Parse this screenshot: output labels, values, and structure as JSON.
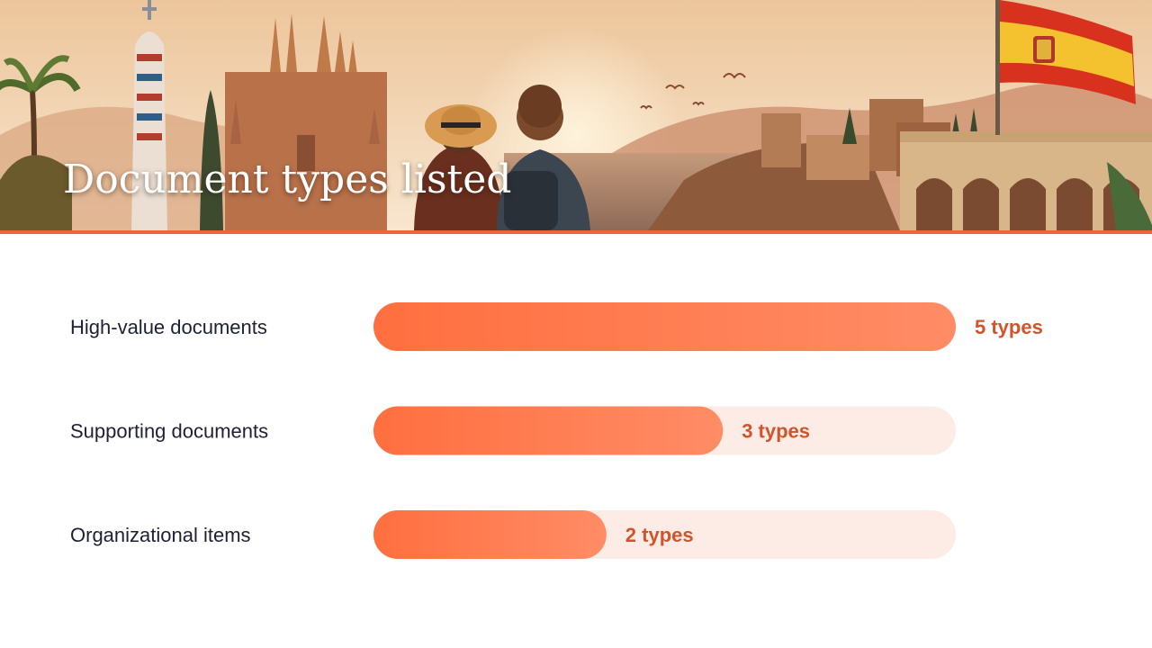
{
  "slide": {
    "title": "Document types listed"
  },
  "colors": {
    "accent": "#f0643a",
    "bar_start": "#ff6f3f",
    "bar_end": "#ff8c66",
    "track": "#fdece6",
    "category_text": "#1c2233",
    "value_text": "#d0542c",
    "hero_rule": "#f0643a",
    "sky_top": "#ecc59b",
    "sky_bottom": "#f8e6cf"
  },
  "hero": {
    "icons": [
      "tower-icon",
      "sagrada-familia-icon",
      "travelers-icon",
      "spain-flag-icon",
      "palm-tree-icon",
      "castle-icon",
      "aqueduct-arch-icon",
      "bird-icon"
    ]
  },
  "chart_data": {
    "type": "bar",
    "orientation": "horizontal",
    "title": "Document types listed",
    "categories": [
      "High-value documents",
      "Supporting documents",
      "Organizational items"
    ],
    "values": [
      5,
      3,
      2
    ],
    "value_labels": [
      "5 types",
      "3 types",
      "2 types"
    ],
    "xlim": [
      0,
      5
    ],
    "grid": false,
    "legend": "none"
  }
}
